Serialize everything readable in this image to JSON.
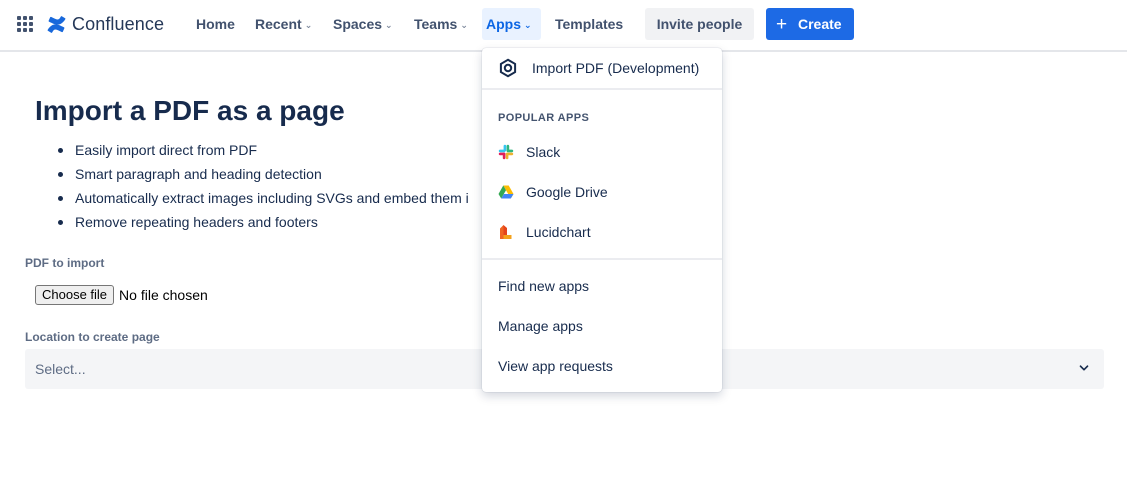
{
  "nav": {
    "logo_text": "Confluence",
    "home": "Home",
    "recent": "Recent",
    "spaces": "Spaces",
    "teams": "Teams",
    "apps": "Apps",
    "templates": "Templates",
    "invite": "Invite people",
    "create": "Create"
  },
  "main": {
    "title": "Import a PDF as a page",
    "features": [
      "Easily import direct from PDF",
      "Smart paragraph and heading detection",
      "Automatically extract images including SVGs and embed them i",
      "Remove repeating headers and footers"
    ],
    "pdf_label": "PDF to import",
    "file_button": "Choose file",
    "file_status": "No file chosen",
    "location_label": "Location to create page",
    "select_placeholder": "Select..."
  },
  "apps_menu": {
    "top_item": "Import PDF (Development)",
    "popular_heading": "POPULAR APPS",
    "popular": [
      {
        "label": "Slack",
        "icon": "slack-icon"
      },
      {
        "label": "Google Drive",
        "icon": "google-drive-icon"
      },
      {
        "label": "Lucidchart",
        "icon": "lucidchart-icon"
      }
    ],
    "actions": [
      "Find new apps",
      "Manage apps",
      "View app requests"
    ]
  },
  "colors": {
    "accent": "#1d6ae5",
    "active_nav_bg": "#e9f2ff",
    "text": "#172b4d"
  }
}
